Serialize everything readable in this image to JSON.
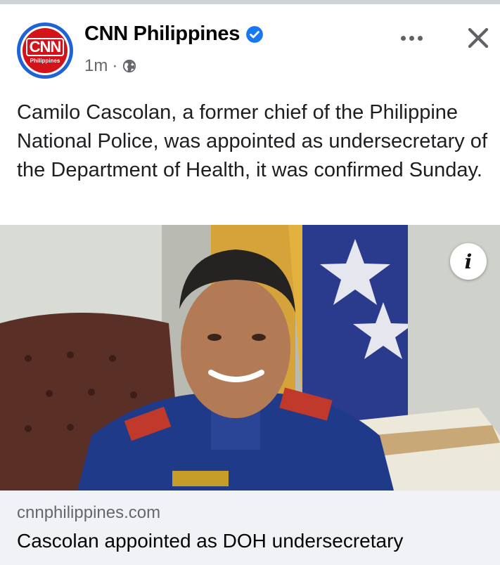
{
  "post": {
    "page_name": "CNN Philippines",
    "verified_icon": "verified-badge-icon",
    "timestamp": "1m",
    "separator": "·",
    "audience_icon": "globe-icon",
    "caption": "Camilo Cascolan, a former chief of the Philippine National Police, was appointed as undersecretary of the Department of Health, it was confirmed Sunday."
  },
  "avatar": {
    "logo_text": "CNN",
    "logo_subtext": "Philippines"
  },
  "actions": {
    "more_icon": "more-options-icon",
    "close_icon": "close-icon"
  },
  "media": {
    "info_label": "i"
  },
  "link_preview": {
    "domain": "cnnphilippines.com",
    "title": "Cascolan appointed as DOH undersecretary"
  },
  "colors": {
    "verified_blue": "#1877f2",
    "avatar_ring": "#1f63d8",
    "logo_red": "#d3121a",
    "meta_gray": "#65676b",
    "card_bg": "#f0f2f5"
  }
}
